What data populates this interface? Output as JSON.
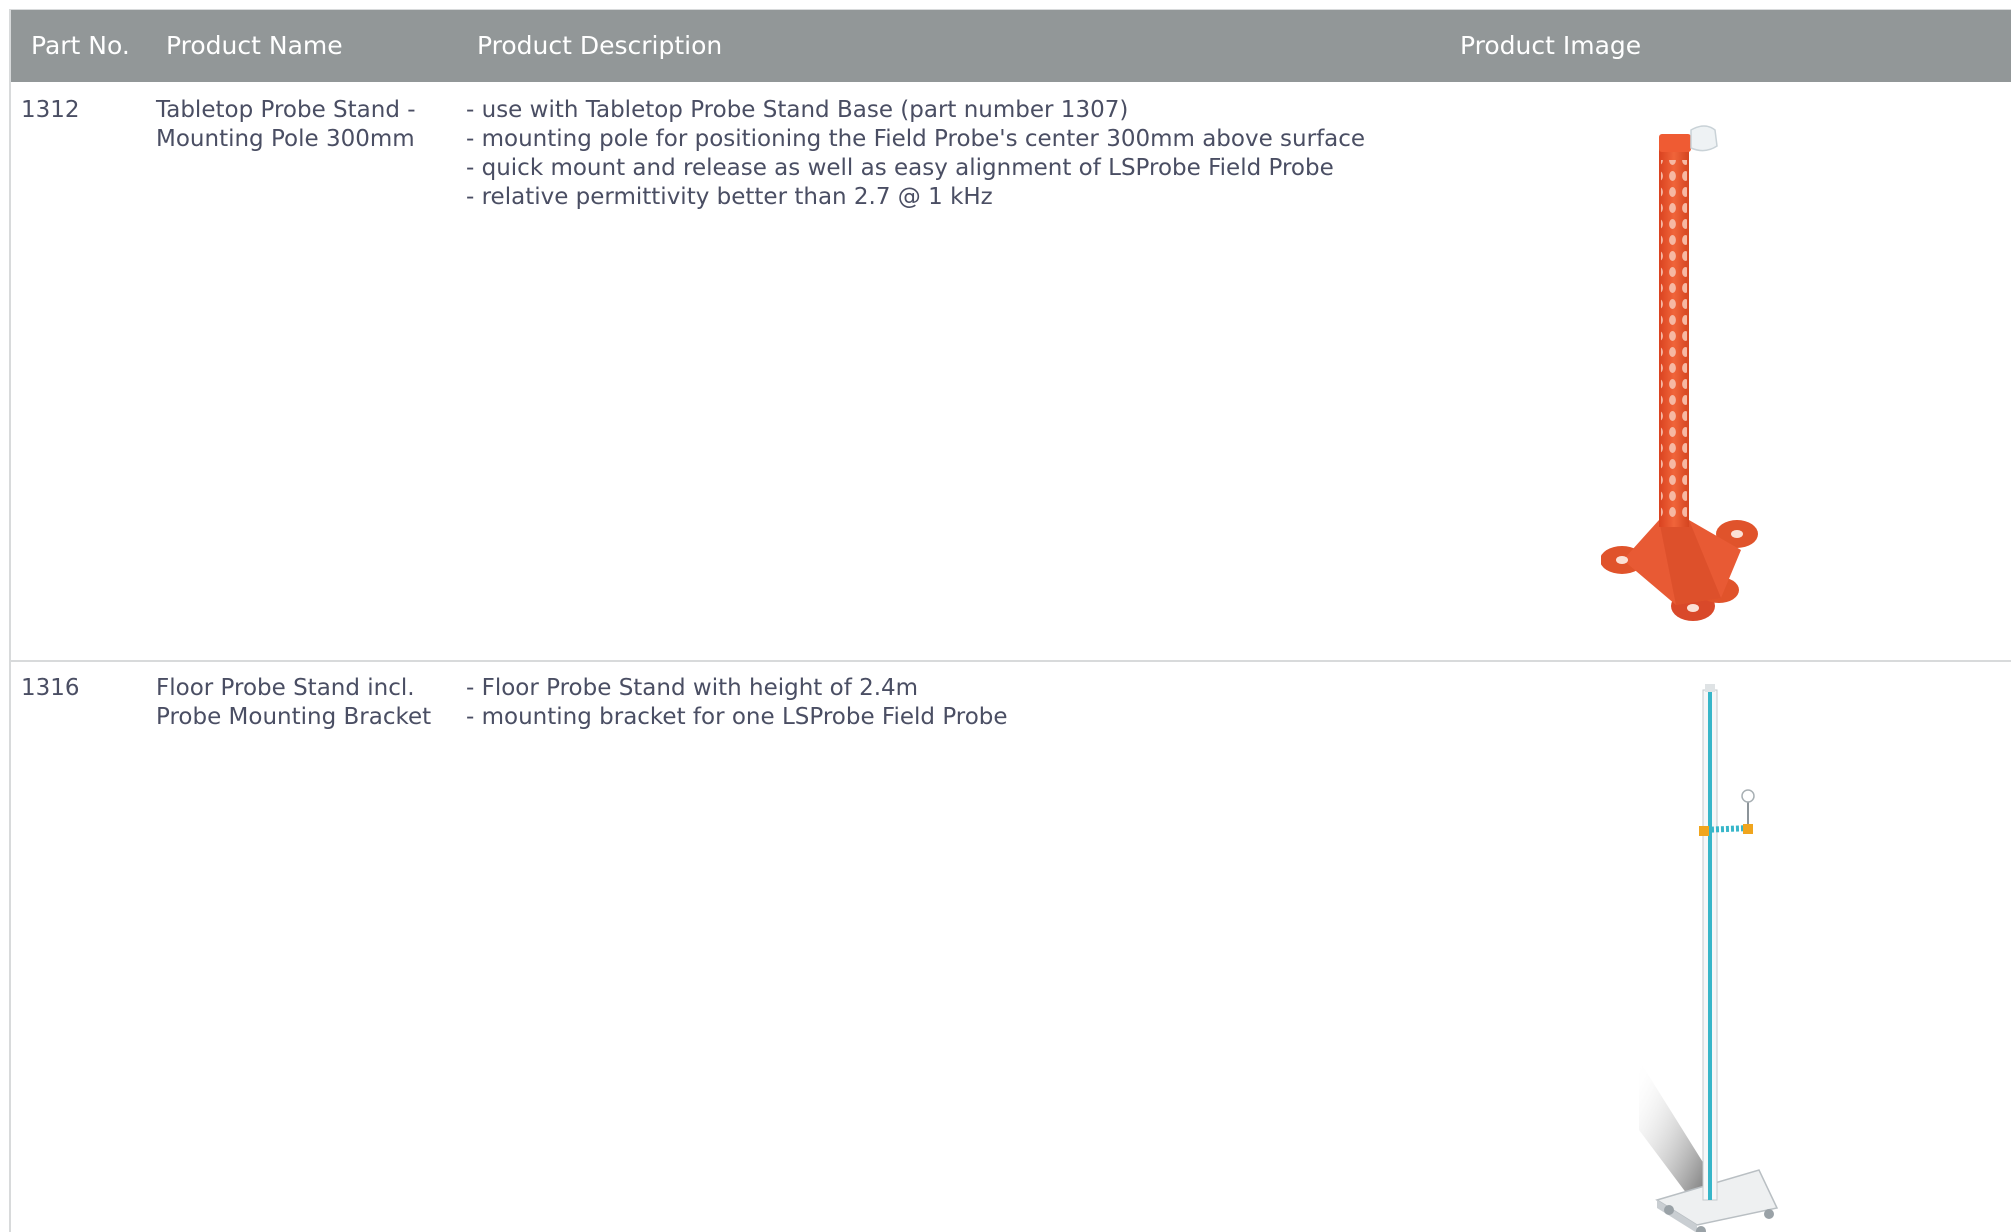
{
  "headers": {
    "part_no": "Part No.",
    "product_name": "Product Name",
    "product_description": "Product Description",
    "product_image": "Product Image"
  },
  "rows": [
    {
      "part_no": "1312",
      "name_lines": [
        "Tabletop Probe Stand -",
        "Mounting Pole 300mm"
      ],
      "description_lines": [
        "- use with Tabletop Probe Stand Base (part number 1307)",
        "- mounting pole for positioning the Field Probe's center 300mm above surface",
        "- quick mount and release as well as easy alignment of LSProbe Field Probe",
        "- relative permittivity better than 2.7 @ 1 kHz"
      ],
      "image": "orange perforated mounting pole with four-lobed base"
    },
    {
      "part_no": "1316",
      "name_lines": [
        "Floor Probe Stand incl.",
        "Probe Mounting Bracket"
      ],
      "description_lines": [
        "- Floor Probe Stand with height of 2.4m",
        "- mounting bracket for one LSProbe Field Probe"
      ],
      "image": "tall white floor stand with probe bracket"
    }
  ],
  "colors": {
    "header_bg": "#929798",
    "header_text": "#ffffff",
    "body_text": "#4a4e63",
    "pole_orange": "#e9532e",
    "stand_teal": "#37b6c9"
  }
}
